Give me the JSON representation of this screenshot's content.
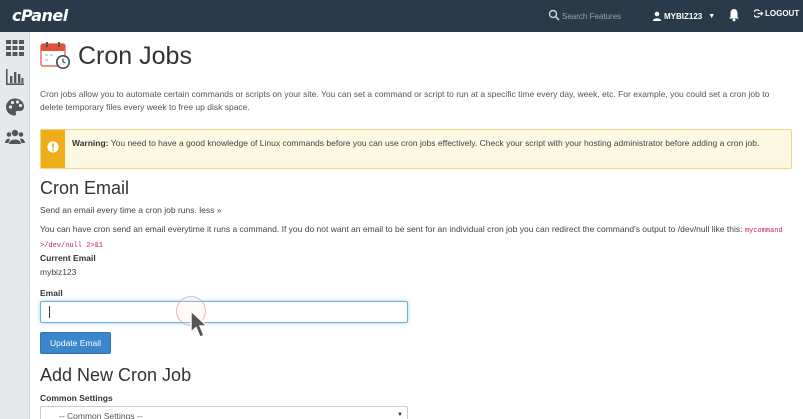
{
  "brand": "cPanel",
  "header": {
    "search_placeholder": "Search Features",
    "username": "MYBIZ123",
    "logout_label": "LOGOUT"
  },
  "sidebar": {
    "items": [
      {
        "icon": "grid-icon"
      },
      {
        "icon": "bar-chart-icon"
      },
      {
        "icon": "palette-icon"
      },
      {
        "icon": "users-icon"
      }
    ]
  },
  "page": {
    "title": "Cron Jobs",
    "intro": "Cron jobs allow you to automate certain commands or scripts on your site. You can set a command or script to run at a specific time every day, week, etc. For example, you could set a cron job to delete temporary files every week to free up disk space.",
    "warning": {
      "label": "Warning:",
      "text": "You need to have a good knowledge of Linux commands before you can use cron jobs effectively. Check your script with your hosting administrator before adding a cron job."
    }
  },
  "cron_email": {
    "heading": "Cron Email",
    "description": "Send an email every time a cron job runs.",
    "less_link": "less »",
    "detail": "You can have cron send an email everytime it runs a command. If you do not want an email to be sent for an individual cron job you can redirect the command's output to /dev/null like this:",
    "code_example": "mycommand >/dev/null 2>&1",
    "current_email_label": "Current Email",
    "current_email_value": "mybiz123",
    "email_label": "Email",
    "email_value": "",
    "update_button": "Update Email"
  },
  "add_cron": {
    "heading": "Add New Cron Job",
    "common_settings_label": "Common Settings",
    "common_settings_selected": "-- Common Settings --"
  },
  "colors": {
    "topbar": "#293a4a",
    "primary_button": "#3b87cc",
    "warning_bar": "#f0ad1a",
    "warning_bg": "#fdf8e2"
  }
}
